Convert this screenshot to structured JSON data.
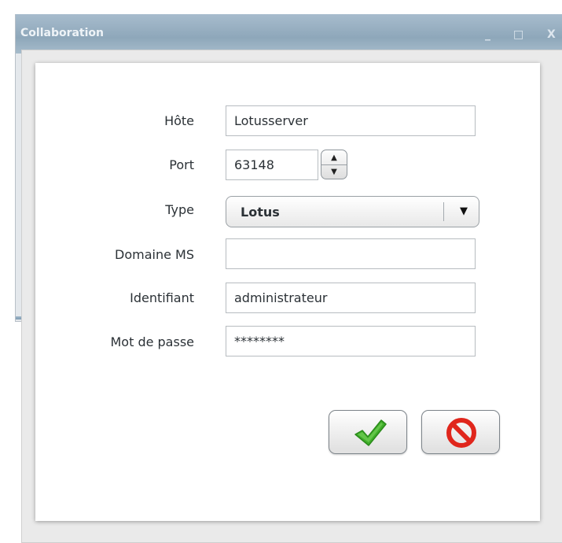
{
  "window": {
    "title": "Collaboration",
    "minimize_glyph": "_",
    "maximize_glyph": "□",
    "close_glyph": "X"
  },
  "form": {
    "host": {
      "label": "Hôte",
      "value": "Lotusserver"
    },
    "port": {
      "label": "Port",
      "value": "63148"
    },
    "type": {
      "label": "Type",
      "value": "Lotus"
    },
    "domain": {
      "label": "Domaine MS",
      "value": ""
    },
    "username": {
      "label": "Identifiant",
      "value": "administrateur"
    },
    "password": {
      "label": "Mot de passe",
      "value": "********"
    }
  },
  "buttons": {
    "confirm_icon": "checkmark-icon",
    "cancel_icon": "prohibited-icon"
  },
  "colors": {
    "confirm_green": "#3fae2a",
    "cancel_red": "#e0261c",
    "titlebar": "#8ea7ba"
  }
}
